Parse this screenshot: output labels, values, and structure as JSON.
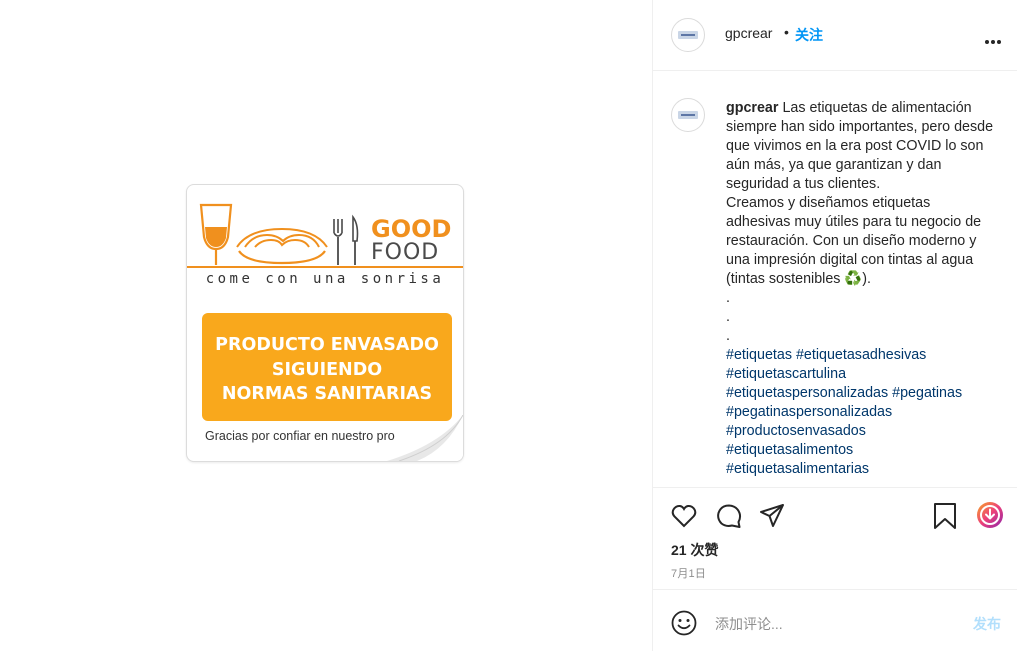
{
  "sticker": {
    "brand_good": "GOOD",
    "brand_food": "FOOD",
    "slogan": "come con una sonrisa",
    "notice_lines": [
      "PRODUCTO ENVASADO",
      "SIGUIENDO",
      "NORMAS SANITARIAS"
    ],
    "thanks": "Gracias por confiar en nuestro pro",
    "colors": {
      "orange": "#f9a81c",
      "brand_orange": "#f0901e"
    }
  },
  "header": {
    "username": "gpcrear",
    "separator": "•",
    "follow_label": "关注",
    "more_icon": "more-horizontal-icon"
  },
  "caption": {
    "username": "gpcrear",
    "paragraph1": "Las etiquetas de alimentación siempre han sido importantes, pero desde que vivimos en la era post COVID lo son aún más, ya que garantizan y dan seguridad a tus clientes.",
    "paragraph2": "Creamos y diseñamos etiquetas adhesivas muy útiles para tu negocio de restauración. Con un diseño moderno y una impresión digital con tintas al agua (tintas sostenibles ♻️).",
    "dots": [
      ".",
      ".",
      "."
    ],
    "hashtags": [
      "#etiquetas",
      "#etiquetasadhesivas",
      "#etiquetascartulina",
      "#etiquetaspersonalizadas",
      "#pegatinas",
      "#pegatinaspersonalizadas",
      "#productosenvasados",
      "#etiquetasalimentos",
      "#etiquetasalimentarias"
    ]
  },
  "actions": {
    "icons": [
      "heart-icon",
      "comment-icon",
      "share-icon",
      "bookmark-icon",
      "download-icon"
    ],
    "likes": "21 次赞",
    "date": "7月1日"
  },
  "comment": {
    "emoji_icon": "emoji-icon",
    "placeholder": "添加评论...",
    "post_label": "发布",
    "post_color": "#b2dffc"
  }
}
